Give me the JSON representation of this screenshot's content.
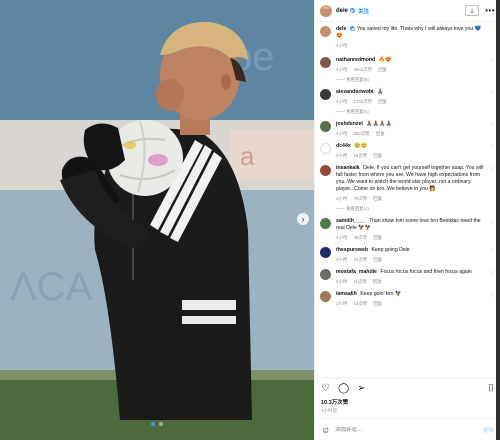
{
  "post": {
    "author": "dele",
    "follow_label": "关注",
    "download_icon": "download-icon",
    "more_icon": "more-options-icon"
  },
  "caption": {
    "user": "dele",
    "text": "You saved my life. Thats why I will always love you 💙😍",
    "time": "3小时"
  },
  "comments": [
    {
      "user": "nathanredmond",
      "text": "🔥😍",
      "time": "3小时",
      "likes": "2942次赞",
      "reply": "回复",
      "replies": "—— 查看回复(5)",
      "avatar_color": "#7a5a4a"
    },
    {
      "user": "alexanderiwobi",
      "text": "🙏🏾",
      "time": "3小时",
      "likes": "1232次赞",
      "reply": "回复",
      "replies": "—— 查看回复(4)",
      "avatar_color": "#3b3b3b"
    },
    {
      "user": "joshdenzel",
      "text": "🙏🏾🙏🏾🙏🏾🙏🏾",
      "time": "3小时",
      "likes": "552次赞",
      "reply": "回复",
      "replies": "",
      "avatar_color": "#5b6e4f"
    },
    {
      "user": "dc44x",
      "text": "😊😊",
      "time": "3小时",
      "likes": "18次赞",
      "reply": "回复",
      "replies": "",
      "avatar_color": "#ffffff"
    },
    {
      "user": "insankaik",
      "text": "Dele, If you can't get yourself together asap. You will fall faster from where you are. We have high expectations from you..We want to watch the world star player..not a ordinary player...Come on bro..We believe in you 👩",
      "time": "3小时",
      "likes": "70次赞",
      "reply": "回复",
      "replies": "—— 查看回复(4)",
      "avatar_color": "#9b4a3a"
    },
    {
      "user": "samiiih____",
      "text": "Than show him some love bro Besiktas need the real Dele 🦅🦅",
      "time": "3小时",
      "likes": "45次赞",
      "reply": "回复",
      "replies": "",
      "avatar_color": "#4f7a4a"
    },
    {
      "user": "thespursweb",
      "text": "Keep going Dele",
      "time": "3小时",
      "likes": "10次赞",
      "reply": "回复",
      "replies": "",
      "avatar_color": "#1c2a6e"
    },
    {
      "user": "mostafa_mahdie",
      "text": "Focus focus focus and then focus again",
      "time": "3小时",
      "likes": "11次赞",
      "reply": "回复",
      "replies": "",
      "avatar_color": "#6e6a66"
    },
    {
      "user": "iamsalih",
      "text": "Keep goin' bro 🦅",
      "time": "3小时",
      "likes": "19次赞",
      "reply": "回复",
      "replies": "",
      "avatar_color": "#9a7a5a"
    }
  ],
  "actions": {
    "heart_icon": "heart-icon",
    "comment_icon": "comment-icon",
    "share_icon": "share-icon",
    "save_icon": "bookmark-icon"
  },
  "likes_text": "10.3万次赞",
  "date_text": "3小时前",
  "add_comment": {
    "placeholder": "添加评论...",
    "post_label": "发布"
  },
  "colors": {
    "accent": "#0095f6",
    "verified": "#3b97f0"
  }
}
